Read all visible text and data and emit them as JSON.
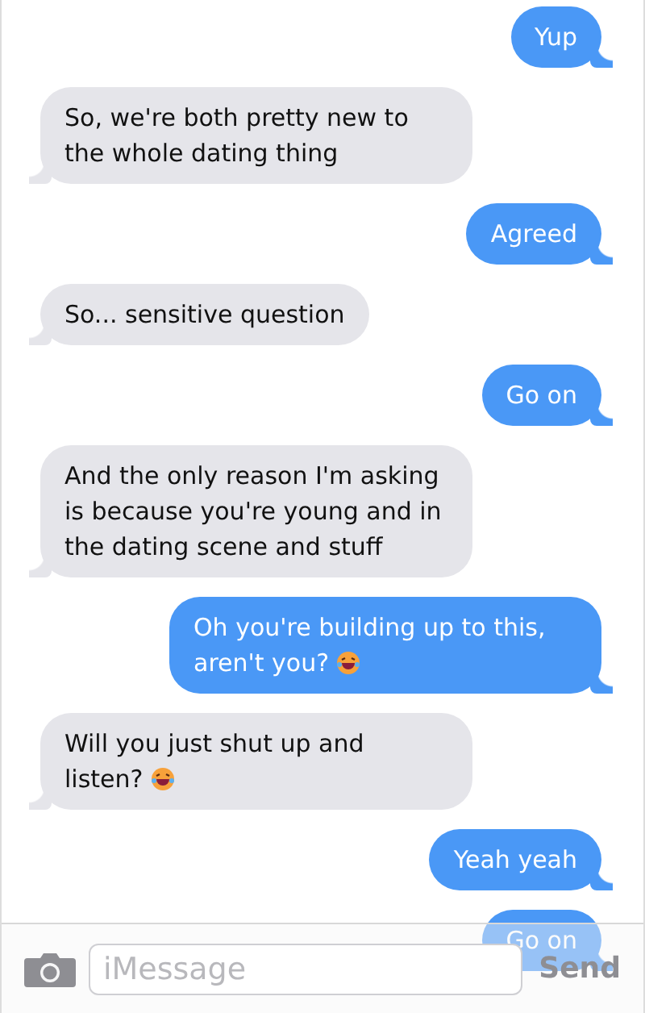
{
  "messages": [
    {
      "kind": "sent",
      "text": "Yup",
      "emoji": false
    },
    {
      "kind": "received",
      "text": "So, we're both pretty new to the whole dating thing",
      "emoji": false
    },
    {
      "kind": "sent",
      "text": "Agreed",
      "emoji": false
    },
    {
      "kind": "received",
      "text": "So... sensitive question",
      "emoji": false
    },
    {
      "kind": "sent",
      "text": "Go on",
      "emoji": false
    },
    {
      "kind": "received",
      "text": "And the only reason I'm asking is because you're young and in the dating scene and stuff",
      "emoji": false
    },
    {
      "kind": "sent",
      "text": "Oh you're building up to this, aren't you?",
      "emoji": true
    },
    {
      "kind": "received",
      "text": "Will you just shut up and listen?",
      "emoji": true
    },
    {
      "kind": "sent",
      "text": "Yeah yeah",
      "emoji": false
    },
    {
      "kind": "sent",
      "text": "Go on",
      "emoji": false
    }
  ],
  "compose": {
    "placeholder": "iMessage",
    "send": "Send"
  }
}
